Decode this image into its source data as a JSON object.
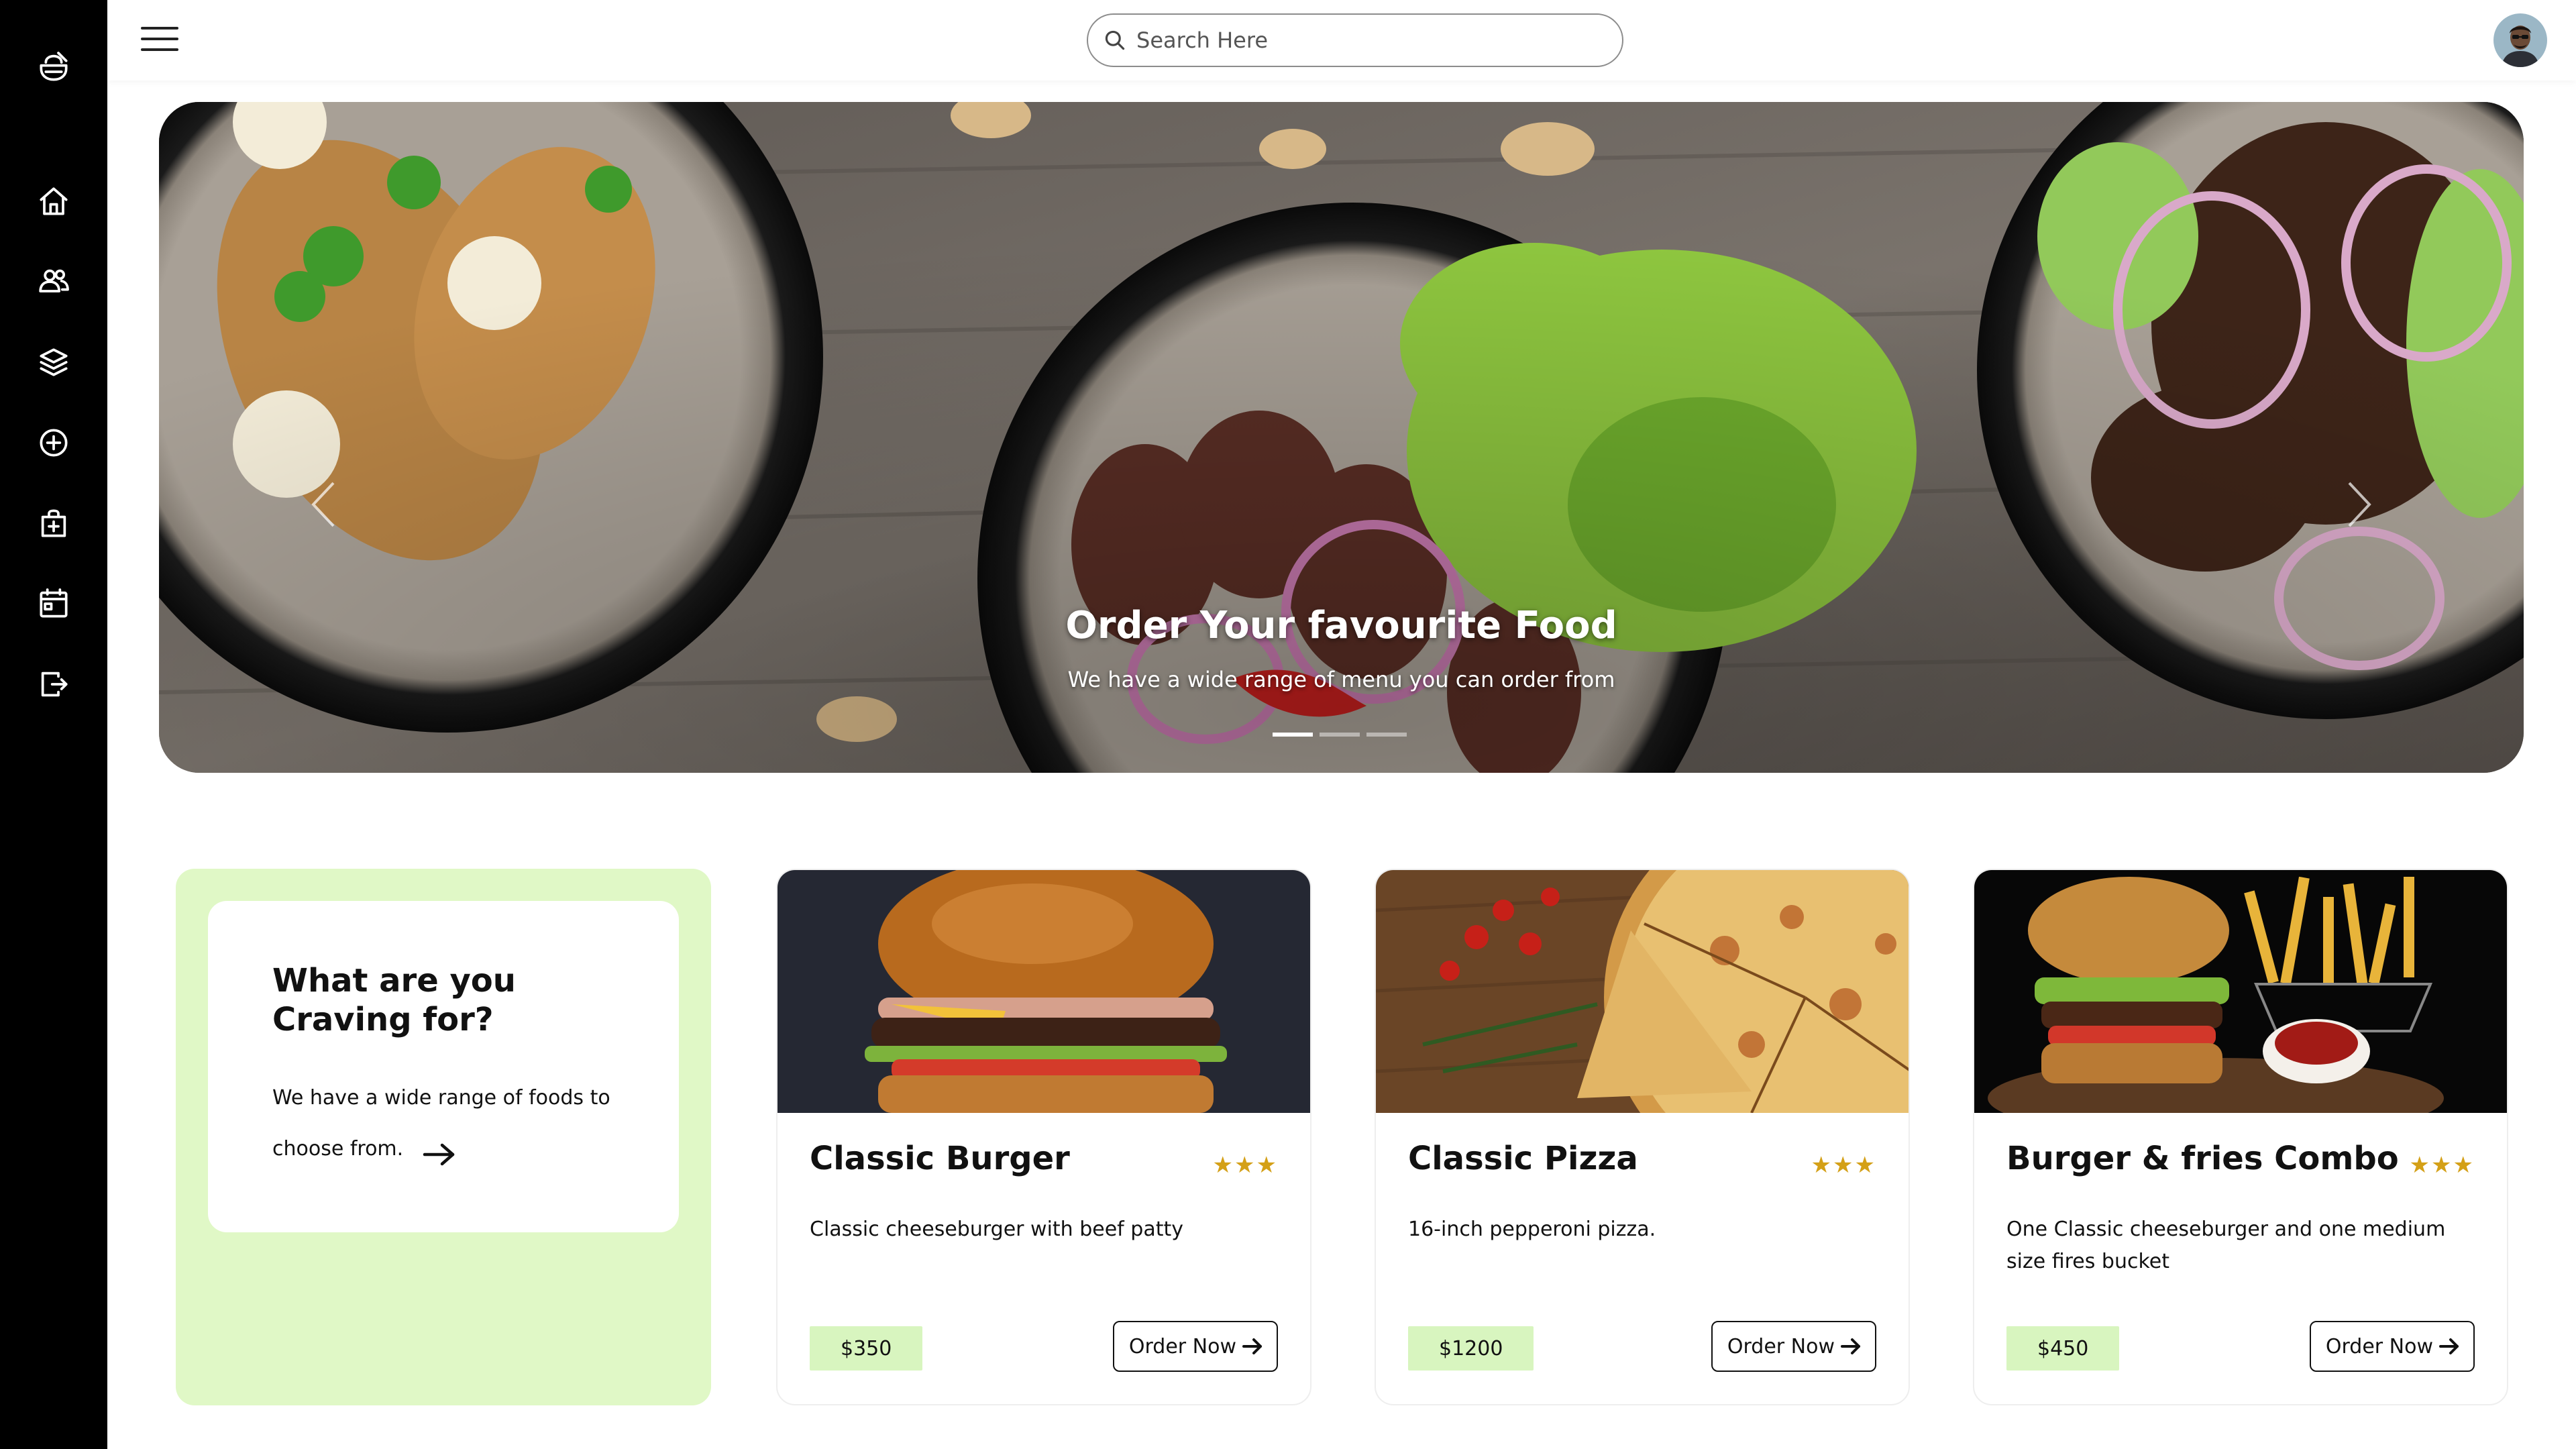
{
  "search": {
    "placeholder": "Search Here"
  },
  "sidebar": {
    "items": [
      {
        "icon": "food-logo-icon"
      },
      {
        "icon": "home-icon"
      },
      {
        "icon": "users-icon"
      },
      {
        "icon": "layers-icon"
      },
      {
        "icon": "plus-circle-icon"
      },
      {
        "icon": "bag-add-icon"
      },
      {
        "icon": "calendar-icon"
      },
      {
        "icon": "logout-icon"
      }
    ]
  },
  "hero": {
    "title": "Order Your favourite Food",
    "subtitle": "We have a wide range of menu you can order from",
    "slides": 3,
    "active_slide": 1
  },
  "craving": {
    "title": "What are you Craving for?",
    "text": "We have a wide range of foods to choose from."
  },
  "products": [
    {
      "name": "Classic Burger",
      "rating": 3,
      "stars": "★★★",
      "description": "Classic cheeseburger with beef patty",
      "price": "$350",
      "button": "Order Now"
    },
    {
      "name": "Classic Pizza",
      "rating": 3,
      "stars": "★★★",
      "description": "16-inch pepperoni pizza.",
      "price": "$1200",
      "button": "Order Now"
    },
    {
      "name": "Burger & fries Combo",
      "rating": 3,
      "stars": "★★★",
      "description": "One Classic cheeseburger and one medium size fires bucket",
      "price": "$450",
      "button": "Order Now"
    }
  ],
  "colors": {
    "sidebar": "#000000",
    "accent_green": "#e0f8c6",
    "price_green": "#d8f5bf",
    "star": "#d4a017"
  }
}
